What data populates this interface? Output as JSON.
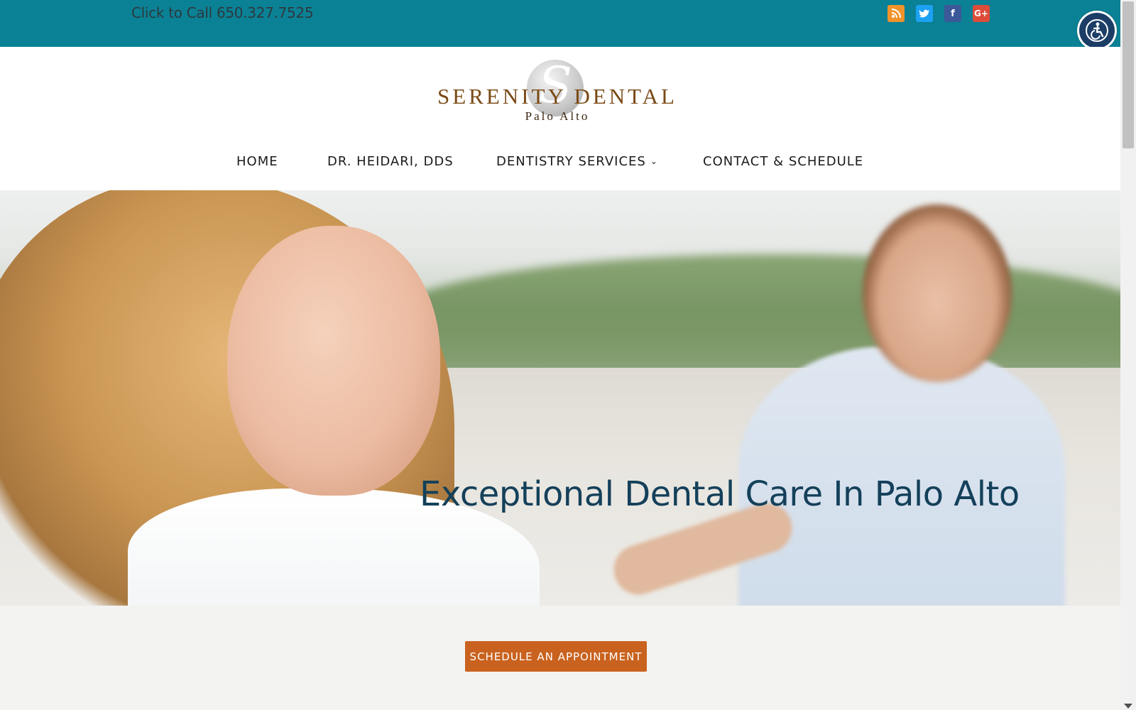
{
  "topbar": {
    "call_text": "Click to Call 650.327.7525",
    "social_icons": [
      "rss-icon",
      "twitter-icon",
      "facebook-icon",
      "google-plus-icon"
    ],
    "bg_color": "#0b8195"
  },
  "accessibility": {
    "icon": "accessibility-icon"
  },
  "logo": {
    "name": "SERENITY DENTAL",
    "subtitle": "Palo Alto"
  },
  "nav": {
    "items": [
      {
        "label": "HOME"
      },
      {
        "label": "DR. HEIDARI, DDS"
      },
      {
        "label": "DENTISTRY SERVICES",
        "has_dropdown": true
      },
      {
        "label": "CONTACT & SCHEDULE"
      }
    ]
  },
  "hero": {
    "title": "Exceptional Dental Care In Palo Alto"
  },
  "cta": {
    "label": "SCHEDULE AN APPOINTMENT",
    "color": "#c9621e"
  }
}
